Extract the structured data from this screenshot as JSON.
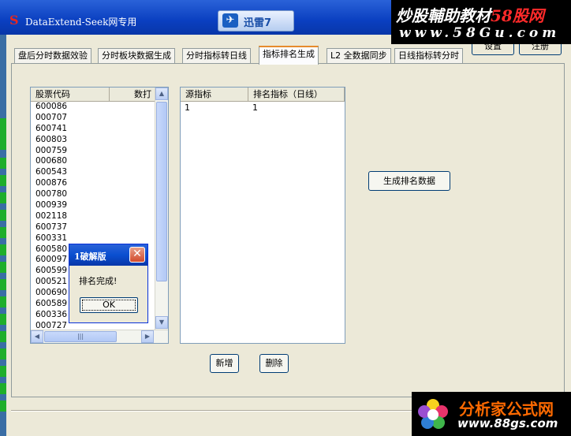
{
  "window": {
    "title": "DataExtend-Seek网专用",
    "buttons": [
      "设置",
      "注册"
    ]
  },
  "overlay_badge": {
    "label": "迅雷7"
  },
  "watermarks": {
    "top_line1": "炒股輔助教材",
    "top_line1_accent": "58股网",
    "top_line2": "www.58Gu.com",
    "bottom_line1": "分析家公式网",
    "bottom_line2": "www.88gs.com"
  },
  "tabs": [
    {
      "label": "盘后分时数据效验",
      "active": false
    },
    {
      "label": "分时板块数据生成",
      "active": false
    },
    {
      "label": "分时指标转日线",
      "active": false
    },
    {
      "label": "指标排名生成",
      "active": true
    },
    {
      "label": "L2 全数据同步",
      "active": false
    },
    {
      "label": "日线指标转分时",
      "active": false
    }
  ],
  "stock_list": {
    "columns": [
      "股票代码",
      "数打"
    ],
    "rows": [
      "600086",
      "000707",
      "600741",
      "600803",
      "000759",
      "000680",
      "600543",
      "000876",
      "000780",
      "000939",
      "002118",
      "600737",
      "600331",
      "600580",
      "600097",
      "600599",
      "000521",
      "000690",
      "600589",
      "600336",
      "000727"
    ]
  },
  "indicator_grid": {
    "columns": [
      "源指标",
      "排名指标（日线）"
    ],
    "rows": [
      [
        "1",
        "1"
      ]
    ]
  },
  "buttons": {
    "generate": "生成排名数据",
    "add": "新增",
    "delete": "删除"
  },
  "dialog": {
    "title": "1破解版",
    "message": "排名完成!",
    "ok": "OK"
  },
  "colors": {
    "window_title_blue": "#0a3fc0",
    "window_bg": "#ece9d8",
    "active_tab_accent": "#e68b2c",
    "close_red": "#d24a2c",
    "watermark_orange": "#ff6a00"
  },
  "icons": [
    "app-logo-icon",
    "xunlei-bird-icon",
    "close-icon",
    "scroll-up-icon",
    "scroll-down-icon",
    "scroll-left-icon",
    "scroll-right-icon",
    "flower-logo-icon"
  ]
}
